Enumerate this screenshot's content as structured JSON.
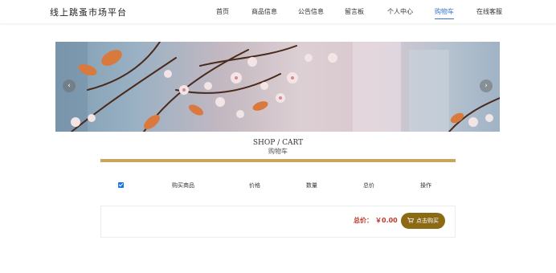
{
  "site": {
    "title": "线上跳蚤市场平台"
  },
  "nav": {
    "items": [
      {
        "label": "首页",
        "active": false
      },
      {
        "label": "商品信息",
        "active": false
      },
      {
        "label": "公告信息",
        "active": false
      },
      {
        "label": "留言板",
        "active": false
      },
      {
        "label": "个人中心",
        "active": false
      },
      {
        "label": "购物车",
        "active": true
      },
      {
        "label": "在线客服",
        "active": false
      }
    ],
    "active_color": "#3b73c7"
  },
  "banner": {
    "prev_icon": "chevron-left-icon",
    "next_icon": "chevron-right-icon"
  },
  "section": {
    "title_en": "SHOP / CART",
    "title_zh": "购物车",
    "accent_color": "#c7a55a"
  },
  "cart": {
    "select_all_checked": true,
    "columns": [
      "购买商品",
      "价格",
      "数量",
      "总价",
      "操作"
    ],
    "total_label": "总价：",
    "total_value": "￥0.00",
    "buy_button": {
      "label": "点击购买",
      "icon": "cart-icon",
      "color": "#8c6a14"
    }
  }
}
